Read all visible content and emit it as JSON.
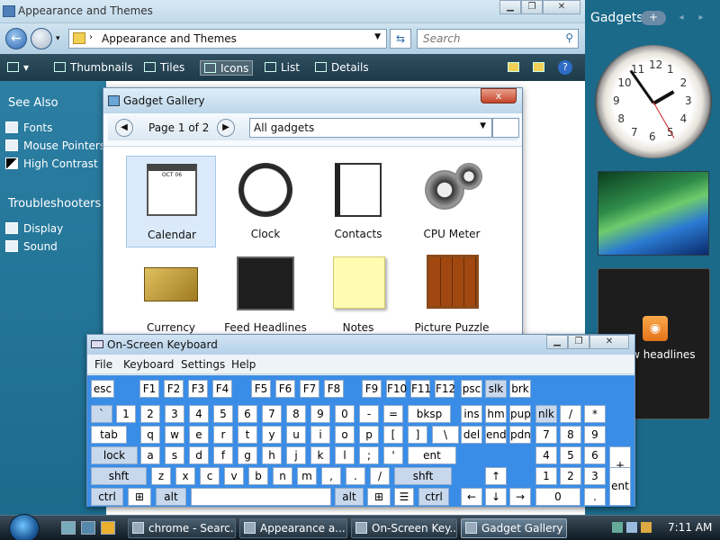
{
  "explorer": {
    "title": "Appearance and Themes",
    "address": "Appearance and Themes",
    "search_placeholder": "Search",
    "toolbar": {
      "thumbnails": "Thumbnails",
      "tiles": "Tiles",
      "icons": "Icons",
      "list": "List",
      "details": "Details"
    },
    "sidebar": {
      "see_also": "See Also",
      "see_also_items": [
        "Fonts",
        "Mouse Pointers",
        "High Contrast"
      ],
      "troubleshooters": "Troubleshooters",
      "troubleshooter_items": [
        "Display",
        "Sound"
      ]
    }
  },
  "gallery": {
    "title": "Gadget Gallery",
    "close": "x",
    "page_label": "Page 1 of 2",
    "filter": "All gadgets",
    "gadgets": [
      "Calendar",
      "Clock",
      "Contacts",
      "CPU Meter",
      "Currency",
      "Feed Headlines",
      "Notes",
      "Picture Puzzle"
    ],
    "cal_month": "OCT 06"
  },
  "sidebar_gadgets": {
    "title": "Gadgets",
    "add": "+",
    "prev": "◂",
    "next": "▸",
    "clock_numbers": [
      "12",
      "1",
      "2",
      "3",
      "4",
      "5",
      "6",
      "7",
      "8",
      "9",
      "10",
      "11"
    ],
    "feed_label": "View headlines"
  },
  "osk": {
    "title": "On-Screen Keyboard",
    "menu": [
      "File",
      "Keyboard",
      "Settings",
      "Help"
    ],
    "rows": [
      [
        "esc",
        "F1",
        "F2",
        "F3",
        "F4",
        "F5",
        "F6",
        "F7",
        "F8",
        "F9",
        "F10",
        "F11",
        "F12",
        "psc",
        "slk",
        "brk"
      ],
      [
        "`",
        "1",
        "2",
        "3",
        "4",
        "5",
        "6",
        "7",
        "8",
        "9",
        "0",
        "-",
        "=",
        "bksp",
        "ins",
        "hm",
        "pup",
        "nlk",
        "/",
        "*"
      ],
      [
        "tab",
        "q",
        "w",
        "e",
        "r",
        "t",
        "y",
        "u",
        "i",
        "o",
        "p",
        "[",
        "]",
        "\\",
        "del",
        "end",
        "pdn",
        "7",
        "8",
        "9"
      ],
      [
        "lock",
        "a",
        "s",
        "d",
        "f",
        "g",
        "h",
        "j",
        "k",
        "l",
        ";",
        "'",
        "ent",
        "4",
        "5",
        "6",
        "+"
      ],
      [
        "shft",
        "z",
        "x",
        "c",
        "v",
        "b",
        "n",
        "m",
        ",",
        ".",
        "/",
        "shft",
        "↑",
        "1",
        "2",
        "3"
      ],
      [
        "ctrl",
        "alt",
        "alt",
        "ctrl",
        "←",
        "↓",
        "→",
        "0",
        ".",
        "ent"
      ]
    ]
  },
  "taskbar": {
    "tasks": [
      "chrome - Searc...",
      "Appearance a...",
      "On-Screen Key...",
      "Gadget Gallery"
    ],
    "time": "7:11 AM"
  },
  "colors": {
    "sidebar": "#1b6b8d",
    "keyboard": "#3a8de6",
    "taskbar": "#0f1a22"
  }
}
